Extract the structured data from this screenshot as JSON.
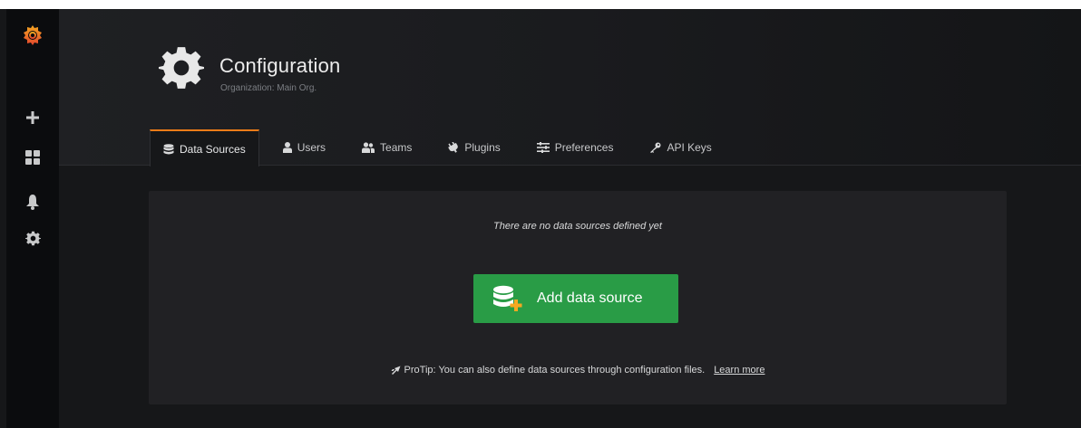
{
  "header": {
    "title": "Configuration",
    "subtitle": "Organization: Main Org."
  },
  "sidebar": {
    "items": [
      {
        "icon": "grafana-logo-icon"
      },
      {
        "icon": "plus-icon"
      },
      {
        "icon": "dashboards-icon"
      },
      {
        "icon": "bell-icon"
      },
      {
        "icon": "gear-icon"
      }
    ]
  },
  "tabs": [
    {
      "label": "Data Sources",
      "icon": "database-icon",
      "active": true
    },
    {
      "label": "Users",
      "icon": "user-icon",
      "active": false
    },
    {
      "label": "Teams",
      "icon": "users-icon",
      "active": false
    },
    {
      "label": "Plugins",
      "icon": "plug-icon",
      "active": false
    },
    {
      "label": "Preferences",
      "icon": "sliders-icon",
      "active": false
    },
    {
      "label": "API Keys",
      "icon": "key-icon",
      "active": false
    }
  ],
  "main": {
    "empty_text": "There are no data sources defined yet",
    "add_button_label": "Add data source",
    "protip_text": "ProTip: You can also define data sources through configuration files.",
    "learn_more_label": "Learn more"
  },
  "colors": {
    "accent": "#eb7b18",
    "button_green": "#299c46",
    "background": "#161719",
    "panel": "#212124"
  }
}
